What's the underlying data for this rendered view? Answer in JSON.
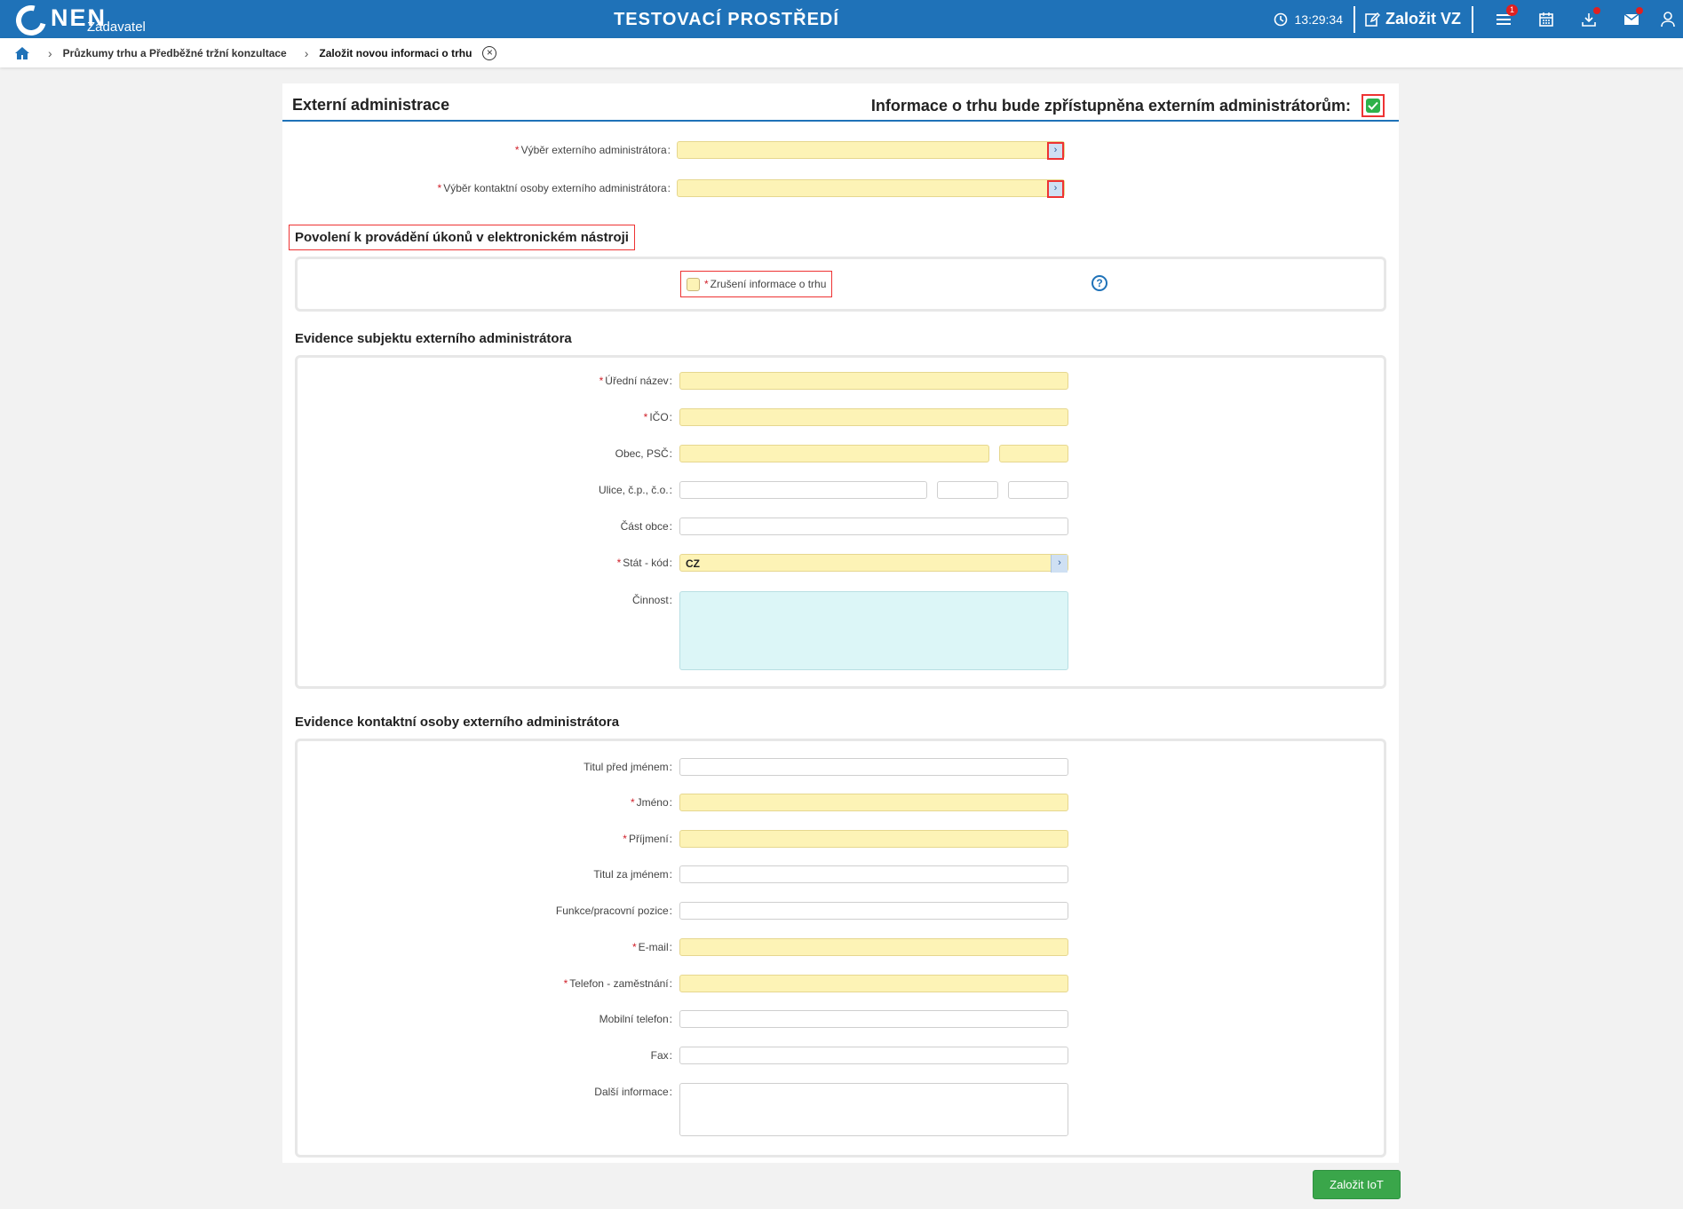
{
  "topbar": {
    "logo": "NEN",
    "logo_sub": "Zadavatel",
    "env_title": "TESTOVACÍ PROSTŘEDÍ",
    "clock": "13:29:34",
    "create_vz": "Založit VZ",
    "menu_badge": "1",
    "icons": [
      "clock-icon",
      "edit-icon",
      "menu-icon",
      "calendar-icon",
      "download-icon",
      "mail-icon",
      "user-icon"
    ]
  },
  "breadcrumb": {
    "items": [
      "Průzkumy trhu a Předběžné tržní konzultace"
    ],
    "current": "Založit novou informaci o trhu"
  },
  "panel": {
    "title": "Externí administrace",
    "external_access_label": "Informace o trhu bude zpřístupněna externím administrátorům:",
    "external_access_checked": true
  },
  "selection": {
    "admin_label": "Výběr externího administrátora",
    "contact_label": "Výběr kontaktní osoby externího administrátora"
  },
  "permissions": {
    "title": "Povolení k provádění úkonů v elektronickém nástroji",
    "cancel_label": "Zrušení informace o trhu",
    "cancel_checked": false,
    "help": "?"
  },
  "subject": {
    "title": "Evidence subjektu externího administrátora",
    "official_name_label": "Úřední název",
    "ico_label": "IČO",
    "city_label": "Obec, PSČ",
    "street_label": "Ulice, č.p., č.o.",
    "district_label": "Část obce",
    "country_label": "Stát - kód",
    "country_value": "CZ",
    "activity_label": "Činnost"
  },
  "contact": {
    "title": "Evidence kontaktní osoby externího administrátora",
    "title_before_label": "Titul před jménem",
    "first_name_label": "Jméno",
    "last_name_label": "Příjmení",
    "title_after_label": "Titul za jménem",
    "position_label": "Funkce/pracovní pozice",
    "email_label": "E-mail",
    "phone_label": "Telefon - zaměstnání",
    "mobile_label": "Mobilní telefon",
    "fax_label": "Fax",
    "other_label": "Další informace"
  },
  "actions": {
    "submit": "Založit IoT"
  },
  "colors": {
    "brand": "#1f72b8",
    "required_field": "#fdf3b6",
    "textarea_field": "#dcf6f7",
    "success": "#3aa64a",
    "highlight": "#e33333"
  }
}
